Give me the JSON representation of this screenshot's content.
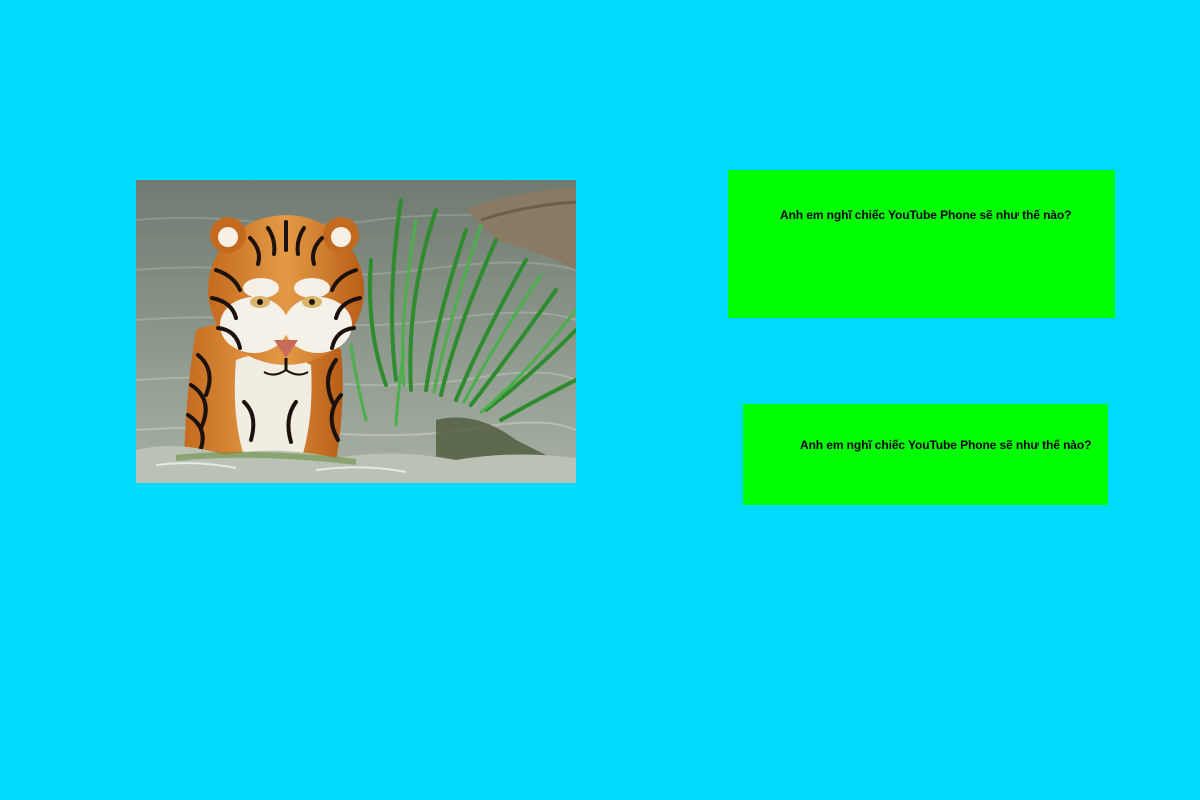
{
  "page": {
    "background_color": "#00DBFF"
  },
  "image": {
    "subject": "tiger-in-water-photo",
    "alt": ""
  },
  "panels": [
    {
      "text": "Anh em nghĩ chiếc YouTube Phone sẽ như thế nào?",
      "background_color": "#00FF00"
    },
    {
      "text": "Anh em nghĩ chiếc YouTube Phone sẽ như thế nào?",
      "background_color": "#00FF00"
    }
  ]
}
